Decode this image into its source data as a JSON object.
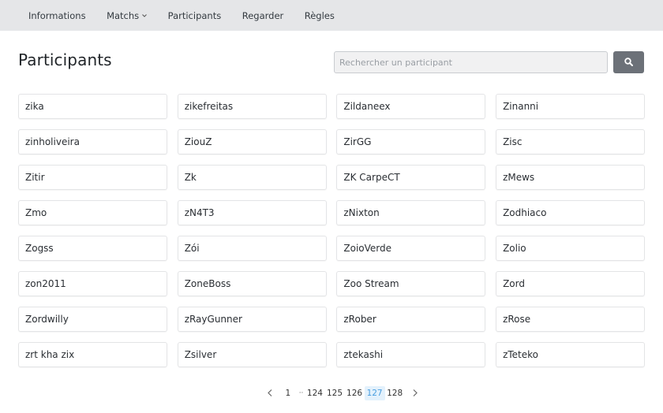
{
  "nav": {
    "items": [
      {
        "label": "Informations",
        "has_dropdown": false
      },
      {
        "label": "Matchs",
        "has_dropdown": true
      },
      {
        "label": "Participants",
        "has_dropdown": false
      },
      {
        "label": "Regarder",
        "has_dropdown": false
      },
      {
        "label": "Règles",
        "has_dropdown": false
      }
    ],
    "dropdown_glyph": "⌄"
  },
  "page": {
    "title": "Participants"
  },
  "search": {
    "value": "",
    "placeholder": "Rechercher un participant",
    "button_icon": "search-icon"
  },
  "participants": [
    "zika",
    "zikefreitas",
    "Zildaneex",
    "Zinanni",
    "zinholiveira",
    "ZiouZ",
    "ZirGG",
    "Zisc",
    "Zitir",
    "Zk",
    "ZK CarpeCT",
    "zMews",
    "Zmo",
    "zN4T3",
    "zNixton",
    "Zodhiaco",
    "Zogss",
    "Zói",
    "ZoioVerde",
    "Zolio",
    "zon2011",
    "ZoneBoss",
    "Zoo Stream",
    "Zord",
    "Zordwilly",
    "zRayGunner",
    "zRober",
    "zRose",
    "zrt kha zix",
    "Zsilver",
    "ztekashi",
    "zTeteko"
  ],
  "pagination": {
    "prev": "‹",
    "next": "›",
    "first": "1",
    "ellipsis": "··",
    "pages": [
      "124",
      "125",
      "126",
      "127",
      "128"
    ],
    "current": "127"
  },
  "colors": {
    "navbar_bg": "#e5e6e8",
    "search_button_bg": "#6c7178",
    "active_page_bg": "#e3f1fc",
    "active_page_text": "#4a9fe0"
  }
}
